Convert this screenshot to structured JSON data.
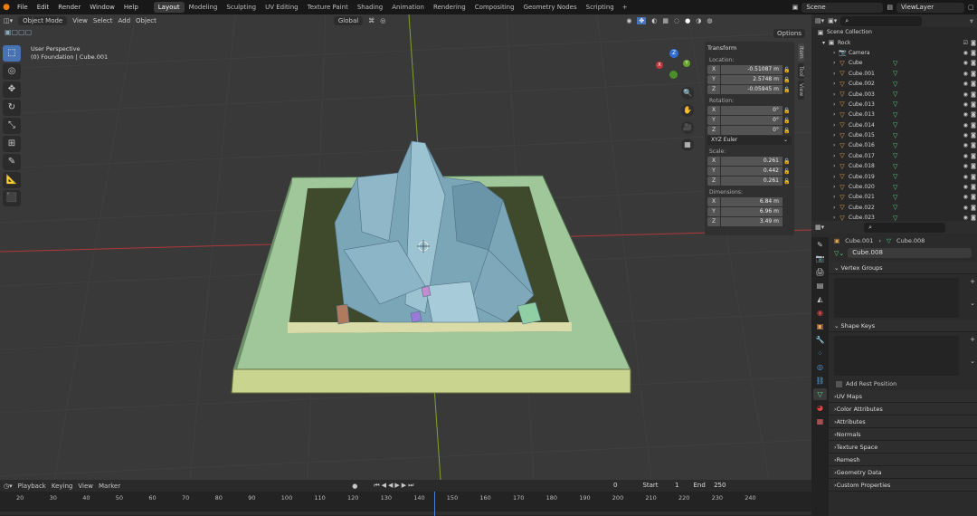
{
  "menu": [
    "File",
    "Edit",
    "Render",
    "Window",
    "Help"
  ],
  "workspaces": [
    "Layout",
    "Modeling",
    "Sculpting",
    "UV Editing",
    "Texture Paint",
    "Shading",
    "Animation",
    "Rendering",
    "Compositing",
    "Geometry Nodes",
    "Scripting"
  ],
  "add_tab": "+",
  "scene": "Scene",
  "view_layer": "ViewLayer",
  "viewport": {
    "mode": "Object Mode",
    "menus": [
      "View",
      "Select",
      "Add",
      "Object"
    ],
    "orientation": "Global",
    "options": "Options",
    "perspective": "User Perspective",
    "collection_info": "(0) Foundation | Cube.001"
  },
  "gizmo": {
    "z": "Z",
    "y": "Y",
    "x": "X"
  },
  "npanel": {
    "title": "Transform",
    "location_label": "Location:",
    "location": [
      {
        "ax": "X",
        "v": "-0.51087 m"
      },
      {
        "ax": "Y",
        "v": "2.5748 m"
      },
      {
        "ax": "Z",
        "v": "-0.05945 m"
      }
    ],
    "rotation_label": "Rotation:",
    "rotation": [
      {
        "ax": "X",
        "v": "0°"
      },
      {
        "ax": "Y",
        "v": "0°"
      },
      {
        "ax": "Z",
        "v": "0°"
      }
    ],
    "rotation_mode": "XYZ Euler",
    "scale_label": "Scale:",
    "scale": [
      {
        "ax": "X",
        "v": "0.261"
      },
      {
        "ax": "Y",
        "v": "0.442"
      },
      {
        "ax": "Z",
        "v": "0.261"
      }
    ],
    "dimensions_label": "Dimensions:",
    "dimensions": [
      {
        "ax": "X",
        "v": "6.84 m"
      },
      {
        "ax": "Y",
        "v": "6.96 m"
      },
      {
        "ax": "Z",
        "v": "3.49 m"
      }
    ],
    "side_tabs": [
      "Item",
      "Tool",
      "View"
    ]
  },
  "timeline": {
    "menus": [
      "Playback",
      "Keying",
      "View",
      "Marker"
    ],
    "current": "0",
    "start_label": "Start",
    "start": "1",
    "end_label": "End",
    "end": "250",
    "ticks": [
      "20",
      "30",
      "40",
      "50",
      "60",
      "70",
      "80",
      "90",
      "100",
      "110",
      "120",
      "130",
      "140",
      "150",
      "160",
      "170",
      "180",
      "190",
      "200",
      "210",
      "220",
      "230",
      "240"
    ]
  },
  "outliner": {
    "search_placeholder": "",
    "root": "Scene Collection",
    "collection": "Rock",
    "items": [
      "Camera",
      "Cube",
      "Cube.001",
      "Cube.002",
      "Cube.003",
      "Cube.013",
      "Cube.013",
      "Cube.014",
      "Cube.015",
      "Cube.016",
      "Cube.017",
      "Cube.018",
      "Cube.019",
      "Cube.020",
      "Cube.021",
      "Cube.022",
      "Cube.023"
    ]
  },
  "properties": {
    "breadcrumb_obj": "Cube.001",
    "breadcrumb_data": "Cube.008",
    "mesh_name": "Cube.008",
    "vertex_groups": "Vertex Groups",
    "shape_keys": "Shape Keys",
    "add_rest": "Add Rest Position",
    "sections": [
      "UV Maps",
      "Color Attributes",
      "Attributes",
      "Normals",
      "Texture Space",
      "Remesh",
      "Geometry Data",
      "Custom Properties"
    ]
  },
  "colors": {
    "accent": "#4772b3",
    "grid_bg": "#393939",
    "x_axis": "#b0383c",
    "y_axis": "#7fa32d",
    "rock": "#7aa6b8",
    "base": "#9fc79a"
  }
}
